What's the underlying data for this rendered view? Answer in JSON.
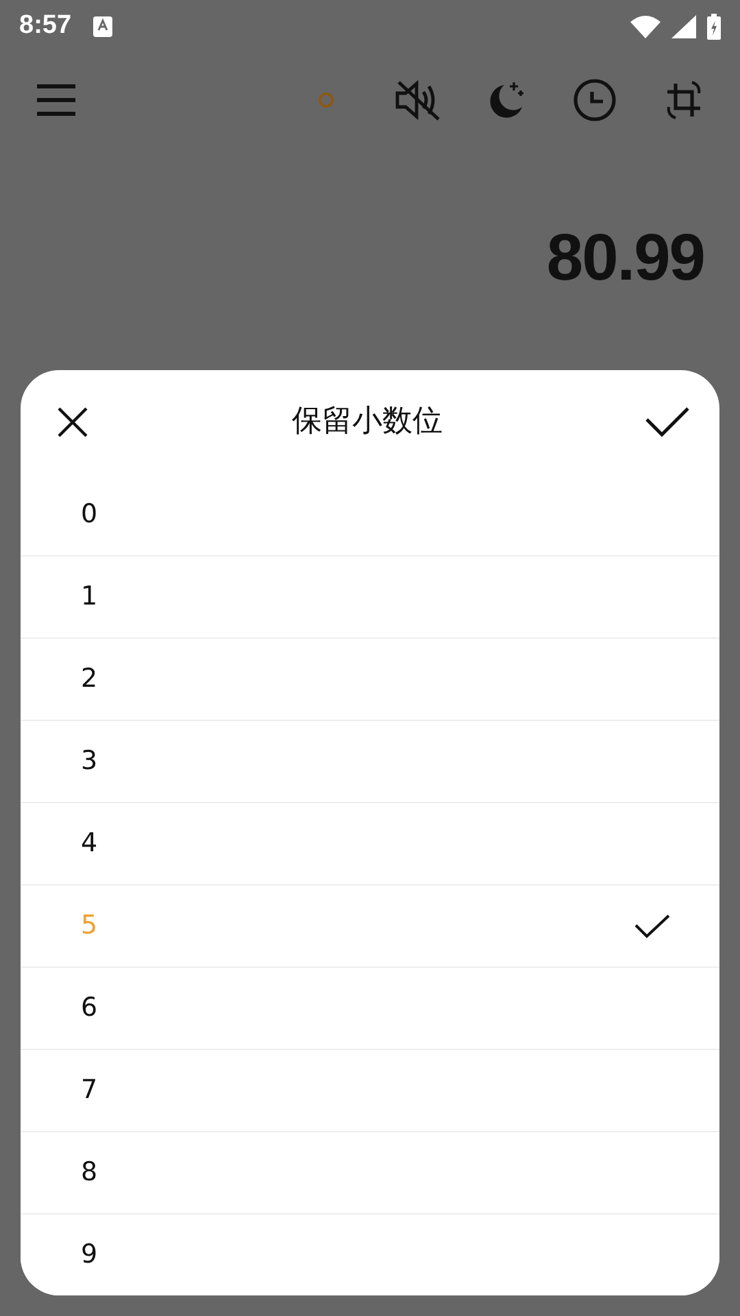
{
  "status_bar": {
    "time": "8:57"
  },
  "display": {
    "value": "80.99"
  },
  "dialog": {
    "title": "保留小数位",
    "options": [
      {
        "label": "0",
        "selected": false
      },
      {
        "label": "1",
        "selected": false
      },
      {
        "label": "2",
        "selected": false
      },
      {
        "label": "3",
        "selected": false
      },
      {
        "label": "4",
        "selected": false
      },
      {
        "label": "5",
        "selected": true
      },
      {
        "label": "6",
        "selected": false
      },
      {
        "label": "7",
        "selected": false
      },
      {
        "label": "8",
        "selected": false
      },
      {
        "label": "9",
        "selected": false
      }
    ]
  }
}
